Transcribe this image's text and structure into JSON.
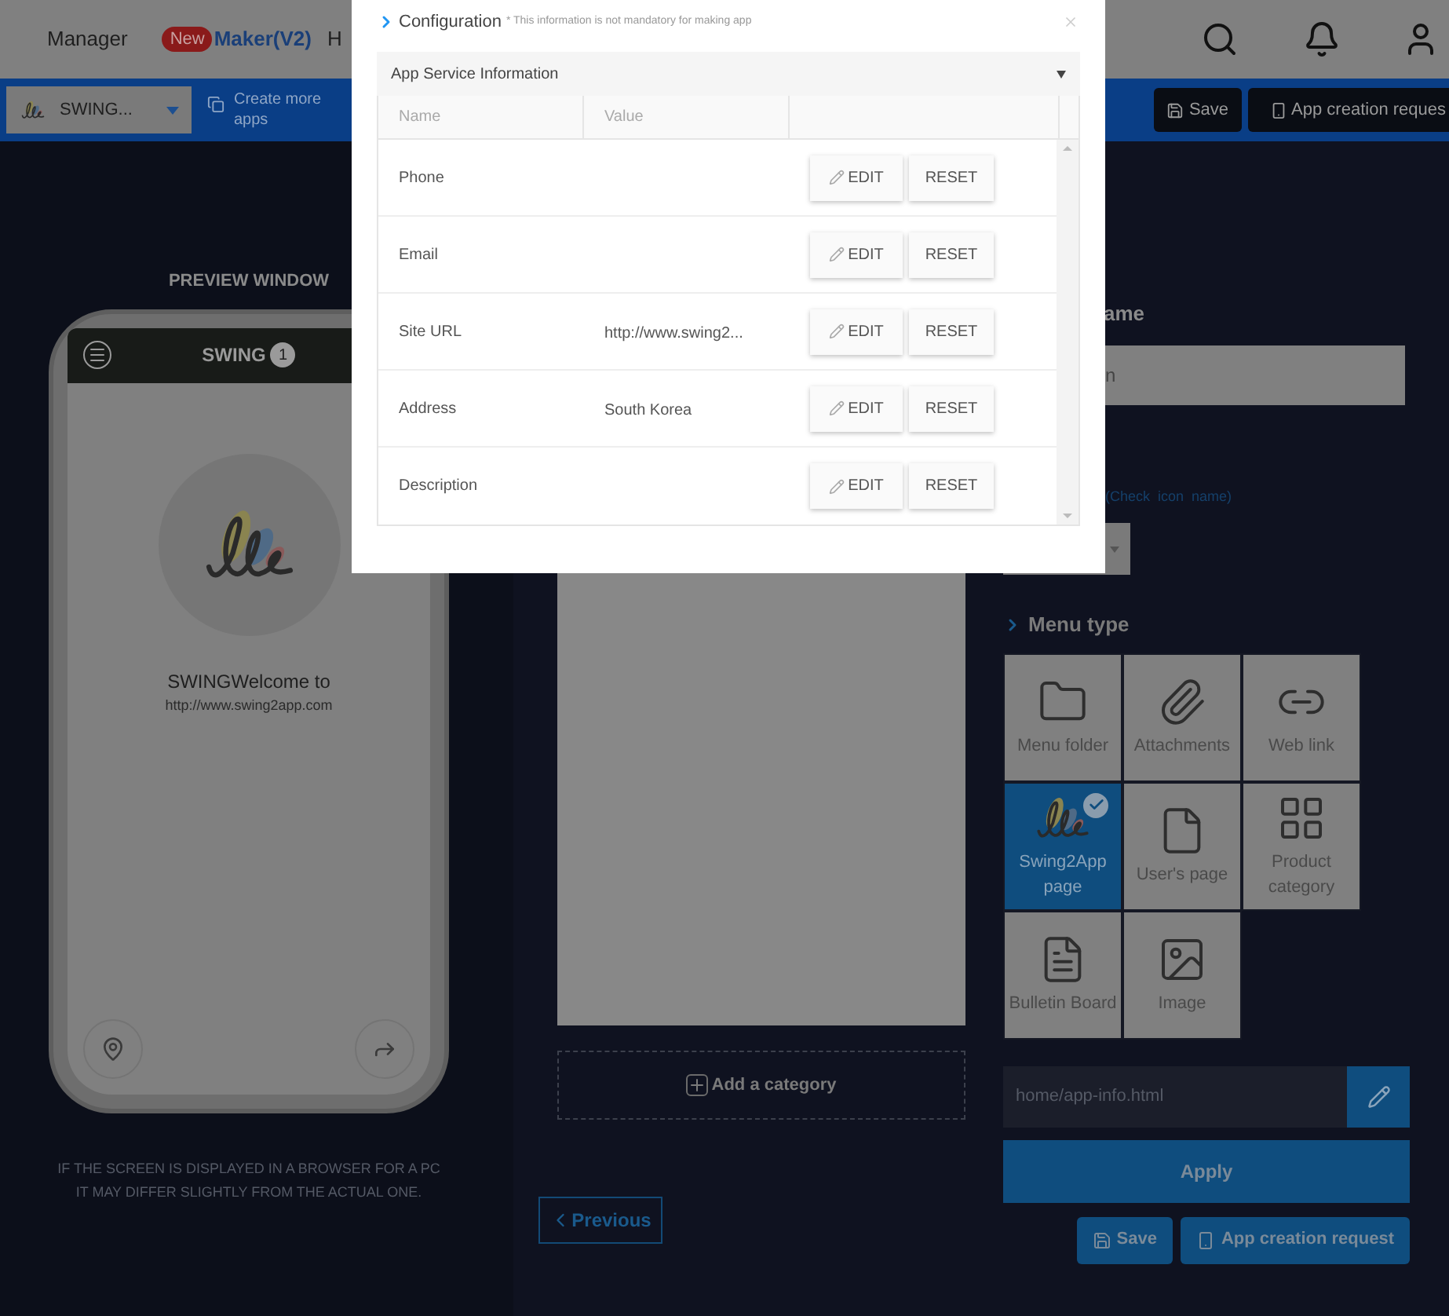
{
  "top_nav": {
    "items": [
      {
        "kind": "plain",
        "label": "Manager"
      },
      {
        "kind": "badge",
        "badge": "New",
        "label": "Maker(V2)"
      },
      {
        "kind": "plain",
        "label": "H"
      }
    ]
  },
  "toolbar": {
    "app_select": "SWING...",
    "create": "Create more apps",
    "save": "Save",
    "request": "App creation reques"
  },
  "preview": {
    "title": "PREVIEW WINDOW",
    "app_title": "SWING",
    "count": "1",
    "welcome": "SWINGWelcome to",
    "url": "http://www.swing2app.com",
    "note": [
      "IF THE SCREEN IS DISPLAYED IN A BROWSER FOR A PC",
      "IT MAY DIFFER SLIGHTLY FROM THE ACTUAL ONE."
    ]
  },
  "category_panel": {
    "add": "Add a category",
    "previous": "Previous"
  },
  "settings": {
    "name_heading": "ame",
    "name_value": "n",
    "icon_hint": "(Check  icon  name)",
    "menu_type_title": "Menu type",
    "menu_types": [
      {
        "kind": "folder",
        "label": "Menu folder",
        "selected": false
      },
      {
        "kind": "paperclip",
        "label": "Attachments",
        "selected": false
      },
      {
        "kind": "link",
        "label": "Web link",
        "selected": false
      },
      {
        "kind": "logo",
        "label": "Swing2App page",
        "selected": true
      },
      {
        "kind": "file",
        "label": "User's page",
        "selected": false
      },
      {
        "kind": "grid",
        "label": "Product category",
        "selected": false
      },
      {
        "kind": "list",
        "label": "Bulletin Board",
        "selected": false
      },
      {
        "kind": "image",
        "label": "Image",
        "selected": false
      }
    ],
    "path": "home/app-info.html",
    "apply": "Apply",
    "save": "Save",
    "request": "App creation request"
  },
  "dialog": {
    "title": "Configuration",
    "note": "* This information is not mandatory for making app",
    "section": "App Service Information",
    "expanded": true,
    "columns": [
      "Name",
      "Value"
    ],
    "rows": [
      {
        "name": "Phone",
        "edit": "EDIT",
        "reset": "RESET"
      },
      {
        "name": "Email",
        "edit": "EDIT",
        "reset": "RESET"
      },
      {
        "name": "Site URL",
        "value": "http://www.swing2...",
        "edit": "EDIT",
        "reset": "RESET"
      },
      {
        "name": "Address",
        "value": "South Korea",
        "edit": "EDIT",
        "reset": "RESET"
      },
      {
        "name": "Description",
        "edit": "EDIT",
        "reset": "RESET"
      }
    ]
  }
}
